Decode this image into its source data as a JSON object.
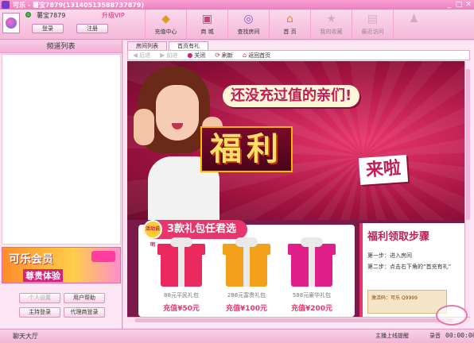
{
  "window": {
    "title": "可乐 - 薯宝7879(13140513588737879)",
    "controls": [
      "_",
      "□",
      "✕"
    ]
  },
  "user": {
    "nickname": "薯宝7879",
    "vip_label": "升级VIP",
    "login_label": "登录",
    "register_label": "注册"
  },
  "toolbar": {
    "items": [
      {
        "label": "充值中心",
        "icon": "coin-icon",
        "glyph": "◆",
        "color": "#d6a21a"
      },
      {
        "label": "商 城",
        "icon": "shop-icon",
        "glyph": "▣",
        "color": "#c9437a"
      },
      {
        "label": "查找房间",
        "icon": "magnifier-icon",
        "glyph": "◎",
        "color": "#7c5cc4"
      },
      {
        "label": "首 页",
        "icon": "home-icon",
        "glyph": "⌂",
        "color": "#e08a2a"
      },
      {
        "label": "我的收藏",
        "icon": "star-icon",
        "glyph": "★",
        "color": "#b07ab0"
      },
      {
        "label": "最近访问",
        "icon": "history-icon",
        "glyph": "▤",
        "color": "#b07ab0"
      },
      {
        "label": "",
        "icon": "user-icon",
        "glyph": "♟",
        "color": "#b07ab0"
      }
    ]
  },
  "sidebar": {
    "title": "频道列表",
    "banner": {
      "line1": "可乐会员",
      "line2": "尊贵体验"
    },
    "buttons": [
      "个人设置",
      "用户帮助",
      "主持登录",
      "代理商登录"
    ]
  },
  "tabs": [
    "房间列表",
    "首页有礼"
  ],
  "nav": {
    "back": "后退",
    "forward": "前进",
    "close": "关闭",
    "refresh": "刷新",
    "home": "返回首页"
  },
  "promo": {
    "headline": "还没充过值的亲们!",
    "welfare": "福利",
    "coming": "来啦",
    "gift_badge": "活动说明",
    "gift_header": "3款礼包任君选",
    "gifts": [
      {
        "label": "88元平民礼包",
        "price": "充值¥50元"
      },
      {
        "label": "288元富贵礼包",
        "price": "充值¥100元"
      },
      {
        "label": "588元豪华礼包",
        "price": "充值¥200元"
      }
    ],
    "steps_title": "福利领取步骤",
    "step1": "第一步：进入房间",
    "step2": "第二步：点击右下角的“首充有礼”",
    "screenshot_text": "激活码：可乐 Q9999"
  },
  "status": {
    "chat_hall": "聊天大厅",
    "host_link": "主播上线提醒",
    "mode": "录音",
    "clock": "00:00:00"
  },
  "colors": {
    "accent": "#e8356b",
    "chrome": "#f6c8e4",
    "titlebar": "#ee7fc0"
  }
}
